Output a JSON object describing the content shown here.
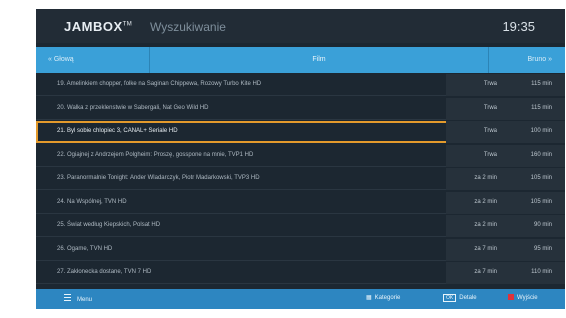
{
  "header": {
    "logo": "JAMBOX",
    "logo_tm": "TM",
    "title": "Wyszukiwanie",
    "time": "19:35"
  },
  "filter_bar": {
    "left_label": "« Głową",
    "center_label": "Film",
    "right_label": "Bruno »"
  },
  "rows": [
    {
      "title": "19. Amelinkiem chopper, folke na Saginan Chippewa, Rozowy Turbo Kite HD",
      "when": "Trwa",
      "duration": "115 min"
    },
    {
      "title": "20. Walka z przeklenstwie w Sabergali, Nat Geo Wild HD",
      "when": "Trwa",
      "duration": "115 min"
    },
    {
      "title": "21. Byl sobie chlopiec 3, CANAL+ Seriale HD",
      "when": "Trwa",
      "duration": "100 min"
    },
    {
      "title": "22. Ogiajnej z Andrzejem Polgheim: Proszę, gosspone na mnie, TVP1 HD",
      "when": "Trwa",
      "duration": "160 min"
    },
    {
      "title": "23. Paranormalnie Tonight: Ander Wladarczyk, Piotr Madarkowski, TVP3 HD",
      "when": "za 2 min",
      "duration": "105 min"
    },
    {
      "title": "24. Na Wspólnej, TVN HD",
      "when": "za 2 min",
      "duration": "105 min"
    },
    {
      "title": "25. Świat według Kiepskich, Polsat HD",
      "when": "za 2 min",
      "duration": "90 min"
    },
    {
      "title": "26. Ogame, TVN HD",
      "when": "za 7 min",
      "duration": "95 min"
    },
    {
      "title": "27. Zakłonecka dostane, TVN 7 HD",
      "when": "za 7 min",
      "duration": "110 min"
    }
  ],
  "selected_index": 2,
  "footer": {
    "menu_label": "Menu",
    "category_label": "Kategorie",
    "ok_key": "OK",
    "ok_label": "Detale",
    "red_label": "Wyjście"
  },
  "colors": {
    "background": "#1c2731",
    "accent": "#3aa0d8",
    "footer": "#2d86c1",
    "selection": "#e39a2c",
    "red_button": "#e0323a"
  }
}
